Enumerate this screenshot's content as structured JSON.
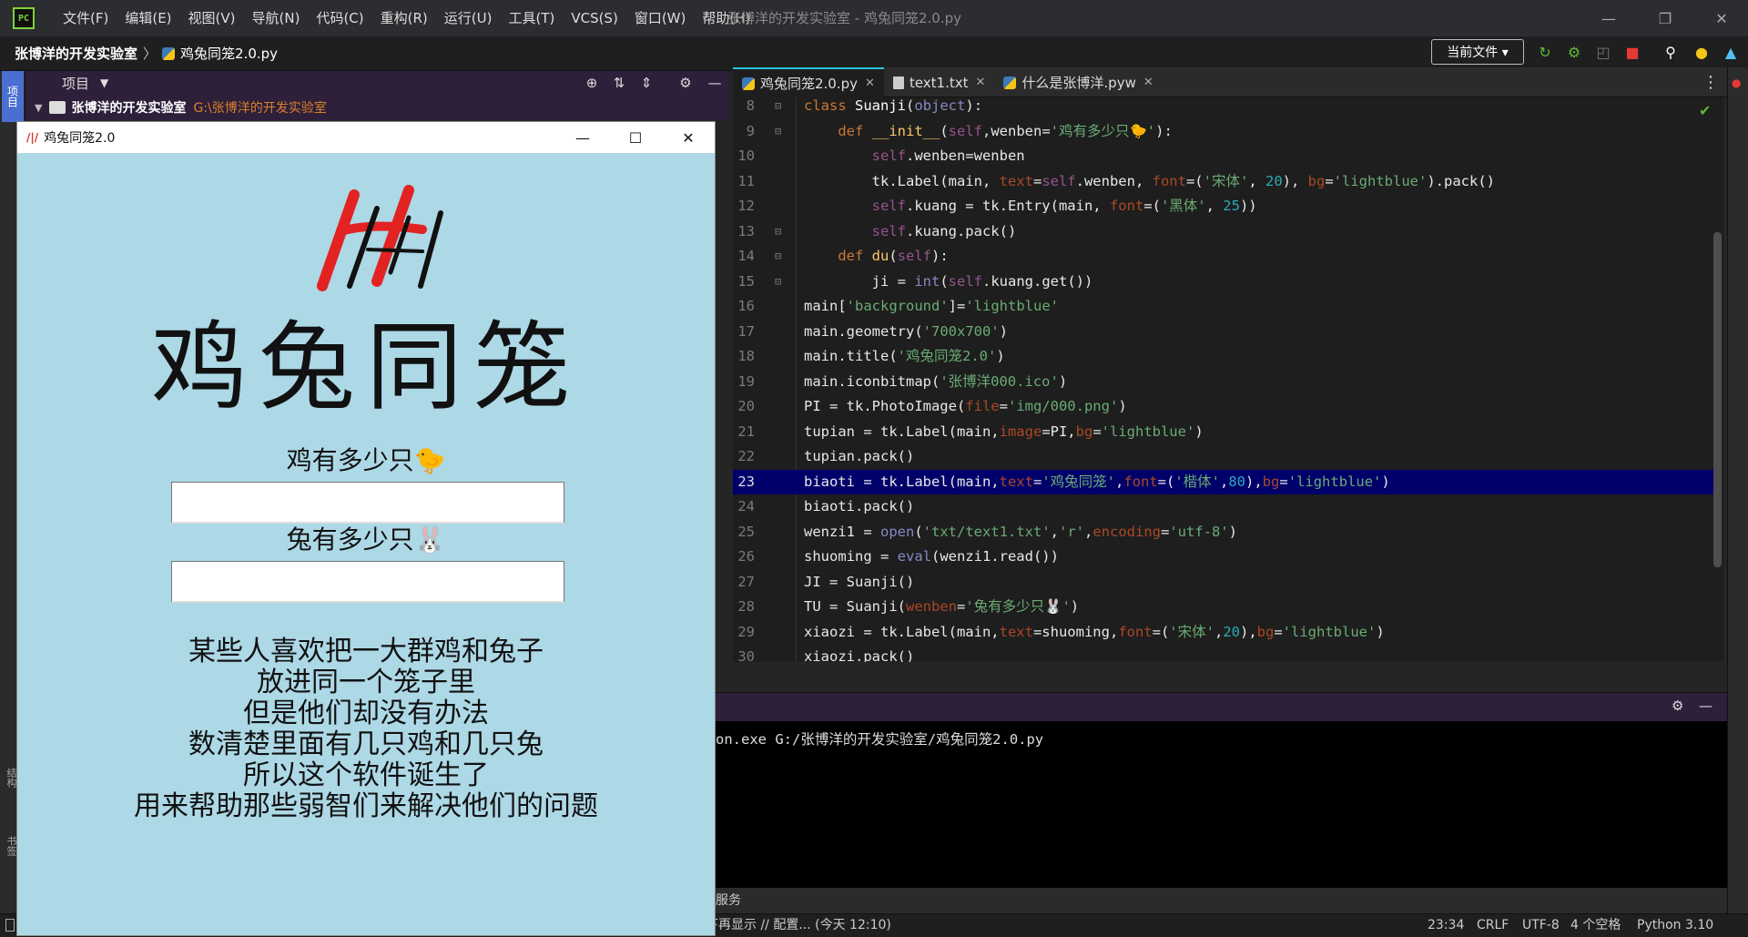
{
  "app": {
    "logo_text": "PC",
    "window_title": "张博洋的开发实验室 - 鸡兔同笼2.0.py",
    "menu": [
      "文件(F)",
      "编辑(E)",
      "视图(V)",
      "导航(N)",
      "代码(C)",
      "重构(R)",
      "运行(U)",
      "工具(T)",
      "VCS(S)",
      "窗口(W)",
      "帮助(H)"
    ]
  },
  "navbar": {
    "project_name": "张博洋的开发实验室",
    "file_name": "鸡兔同笼2.0.py",
    "run_config": "当前文件 ▾"
  },
  "left_strip": {
    "project": "项目",
    "structure": "结构",
    "bookmarks": "书签"
  },
  "project_panel": {
    "title": "项目",
    "root_name": "张博洋的开发实验室",
    "root_path": "G:\\张博洋的开发实验室"
  },
  "tk_window": {
    "title": "鸡兔同笼2.0",
    "heading": "鸡兔同笼",
    "chicken_label": "鸡有多少只🐤",
    "rabbit_label": "兔有多少只🐰",
    "chicken_value": "",
    "rabbit_value": "",
    "description": [
      "某些人喜欢把一大群鸡和兔子",
      "放进同一个笼子里",
      "但是他们却没有办法",
      "数清楚里面有几只鸡和几只兔",
      "所以这个软件诞生了",
      "用来帮助那些弱智们来解决他们的问题"
    ]
  },
  "editor": {
    "tabs": [
      {
        "label": "鸡兔同笼2.0.py",
        "type": "py"
      },
      {
        "label": "text1.txt",
        "type": "txt"
      },
      {
        "label": "什么是张博洋.pyw",
        "type": "py"
      }
    ],
    "current_line": 23,
    "line_numbers": [
      8,
      9,
      10,
      11,
      12,
      13,
      14,
      15,
      16,
      17,
      18,
      19,
      20,
      21,
      22,
      23,
      24,
      25,
      26,
      27,
      28,
      29,
      30
    ]
  },
  "run": {
    "command": "on.exe G:/张博洋的开发实验室/鸡兔同笼2.0.py"
  },
  "services": {
    "label": "服务"
  },
  "statusbar": {
    "message": "下再显示 // 配置... (今天 12:10)",
    "position": "23:34",
    "line_sep": "CRLF",
    "encoding": "UTF-8",
    "indent": "4 个空格",
    "interpreter": "Python 3.10"
  },
  "colors": {
    "accent": "#26c6da",
    "current_line": "#00006b",
    "tk_bg": "#add8e6",
    "panel_header": "#2e1f3a"
  }
}
